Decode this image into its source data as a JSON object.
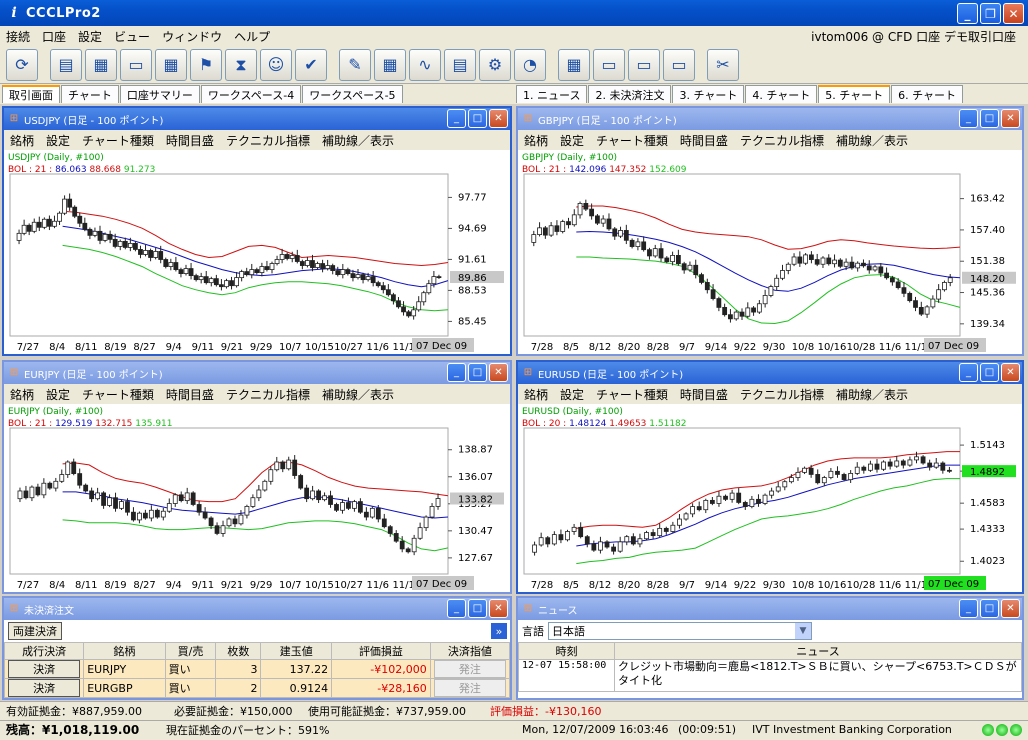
{
  "app": {
    "title": "CCCLPro2",
    "account": "ivtom006 @ CFD 口座 デモ取引口座"
  },
  "menu": [
    "接続",
    "口座",
    "設定",
    "ビュー",
    "ウィンドウ",
    "ヘルプ"
  ],
  "toolbar_icons": [
    "connect-icon",
    "order-list-icon",
    "rate-panel-icon",
    "open-book-icon",
    "calendar-icon",
    "flag-icon",
    "hourglass-icon",
    "contacts-icon",
    "clock-check-icon",
    "pen-icon",
    "spreadsheet-icon",
    "line-chart-icon",
    "document-icon",
    "settings-doc-icon",
    "signal-icon",
    "layout-icon",
    "window-icon",
    "window-minus-icon",
    "window-close-icon",
    "tools-icon"
  ],
  "left_tabs": [
    "取引画面",
    "チャート",
    "口座サマリー",
    "ワークスペース-4",
    "ワークスペース-5"
  ],
  "right_tabs": [
    "1. ニュース",
    "2. 未決済注文",
    "3. チャート",
    "4. チャート",
    "5. チャート",
    "6. チャート"
  ],
  "chart_menu": [
    "銘柄",
    "設定",
    "チャート種類",
    "時間目盛",
    "テクニカル指標",
    "補助線／表示"
  ],
  "chart_data": [
    {
      "type": "candlestick",
      "title": "USDJPY (日足 - 100 ポイント)",
      "symbol_line": "USDJPY (Daily, #100)",
      "bol_label": "BOL : 21 :",
      "bol_mid": "86.063",
      "bol_up": "88.668",
      "bol_low": "91.273",
      "yticks": [
        "97.77",
        "94.69",
        "91.61",
        "88.53",
        "85.45"
      ],
      "last": "89.86",
      "xticks": [
        "7/27",
        "8/4",
        "8/11",
        "8/19",
        "8/27",
        "9/4",
        "9/11",
        "9/21",
        "9/29",
        "10/7",
        "10/15",
        "10/27",
        "11/6",
        "11/16",
        "11/"
      ],
      "date_tag": "07 Dec 09",
      "ylim": [
        84.0,
        99.5
      ],
      "close_path": [
        93.5,
        94.2,
        95.0,
        94.4,
        95.3,
        94.8,
        95.6,
        94.9,
        95.4,
        96.2,
        97.6,
        96.8,
        95.9,
        95.2,
        94.6,
        94.0,
        94.4,
        93.5,
        94.1,
        93.6,
        92.9,
        93.4,
        92.8,
        93.2,
        92.6,
        92.1,
        92.5,
        91.8,
        92.4,
        91.6,
        90.9,
        91.3,
        90.6,
        90.2,
        90.7,
        90.0,
        89.6,
        89.9,
        89.3,
        89.7,
        89.1,
        88.9,
        89.5,
        89.0,
        89.8,
        90.4,
        90.1,
        90.6,
        90.3,
        90.9,
        90.6,
        91.2,
        91.6,
        92.1,
        91.7,
        92.0,
        91.4,
        91.0,
        91.5,
        90.8,
        91.2,
        90.7,
        91.0,
        90.5,
        90.1,
        90.6,
        90.2,
        89.8,
        90.1,
        89.6,
        89.9,
        89.3,
        89.0,
        88.6,
        88.1,
        87.5,
        86.9,
        86.4,
        86.0,
        86.6,
        87.4,
        88.3,
        89.2,
        89.9,
        89.86
      ],
      "mid_path": [
        94.9,
        94.7,
        94.5,
        94.2,
        93.9,
        93.6,
        93.2,
        92.8,
        92.4,
        91.9,
        91.4,
        91.0,
        90.6,
        90.3,
        90.1,
        90.0,
        90.1,
        90.3,
        90.5,
        90.6,
        90.7,
        90.6,
        90.4,
        90.1,
        89.8,
        89.4,
        89.1,
        88.9,
        89.1,
        89.5
      ],
      "up_path": [
        96.4,
        96.3,
        96.1,
        95.9,
        95.6,
        95.2,
        94.7,
        94.0,
        93.2,
        92.6,
        92.1,
        91.8,
        91.9,
        92.4,
        92.9,
        93.0,
        92.8,
        92.3,
        91.8,
        91.9,
        92.0,
        91.9,
        91.8,
        91.6,
        91.4,
        91.2,
        91.1,
        91.0,
        91.1,
        91.3
      ],
      "low_path": [
        93.0,
        92.8,
        92.6,
        92.3,
        91.9,
        91.4,
        90.9,
        90.2,
        89.6,
        89.0,
        88.6,
        88.3,
        88.1,
        88.3,
        88.8,
        89.1,
        89.3,
        89.4,
        89.4,
        89.3,
        89.2,
        89.0,
        88.7,
        88.4,
        88.0,
        87.4,
        86.9,
        86.6,
        86.5,
        86.6
      ]
    },
    {
      "type": "candlestick",
      "title": "GBPJPY (日足 - 100 ポイント)",
      "symbol_line": "GBPJPY (Daily, #100)",
      "bol_label": "BOL : 21 :",
      "bol_mid": "142.096",
      "bol_up": "147.352",
      "bol_low": "152.609",
      "yticks": [
        "163.42",
        "157.40",
        "151.38",
        "145.36",
        "139.34"
      ],
      "last": "148.20",
      "xticks": [
        "7/28",
        "8/5",
        "8/12",
        "8/20",
        "8/28",
        "9/7",
        "9/14",
        "9/22",
        "9/30",
        "10/8",
        "10/16",
        "10/28",
        "11/6",
        "11/16",
        "11/"
      ],
      "date_tag": "07 Dec 09",
      "ylim": [
        137.0,
        167.0
      ],
      "close_path": [
        155.0,
        156.5,
        157.8,
        156.4,
        158.2,
        157.1,
        159.0,
        158.4,
        160.3,
        162.5,
        161.4,
        160.1,
        158.7,
        159.5,
        157.6,
        156.2,
        157.3,
        155.4,
        154.2,
        155.1,
        153.6,
        152.4,
        153.8,
        152.0,
        151.3,
        152.5,
        150.9,
        149.7,
        150.6,
        148.8,
        147.3,
        145.9,
        144.2,
        142.5,
        141.1,
        140.3,
        141.6,
        140.8,
        142.4,
        141.6,
        143.2,
        144.8,
        146.5,
        148.1,
        149.6,
        150.8,
        152.2,
        151.0,
        152.6,
        151.7,
        150.8,
        152.0,
        150.9,
        151.6,
        150.4,
        151.2,
        150.1,
        151.0,
        150.5,
        149.7,
        150.3,
        149.1,
        148.2,
        147.4,
        146.3,
        145.2,
        143.8,
        142.5,
        141.2,
        142.6,
        144.1,
        145.9,
        147.3,
        148.2
      ],
      "mid_path": [
        157.0,
        157.1,
        157.0,
        156.8,
        156.5,
        156.1,
        155.6,
        155.0,
        154.2,
        153.2,
        151.9,
        150.5,
        149.1,
        147.8,
        146.7,
        145.8,
        145.6,
        146.2,
        147.3,
        148.6,
        149.7,
        150.4,
        150.8,
        150.9,
        150.6,
        150.0,
        149.4,
        148.8,
        148.4,
        148.2
      ],
      "up_path": [
        161.8,
        162.0,
        162.0,
        161.7,
        161.2,
        160.6,
        159.7,
        158.5,
        157.5,
        157.0,
        156.7,
        156.5,
        156.3,
        156.1,
        155.5,
        154.5,
        153.7,
        153.8,
        154.4,
        155.2,
        155.5,
        155.3,
        154.9,
        154.6,
        154.3,
        154.1,
        153.9,
        153.8,
        153.9,
        154.1
      ],
      "low_path": [
        152.2,
        152.2,
        152.0,
        151.9,
        151.8,
        151.6,
        151.4,
        151.0,
        150.4,
        149.0,
        146.9,
        144.6,
        142.2,
        140.3,
        139.5,
        139.4,
        139.9,
        141.5,
        143.4,
        145.4,
        147.0,
        148.2,
        148.7,
        148.8,
        148.3,
        146.9,
        145.1,
        143.8,
        143.2,
        142.5
      ]
    },
    {
      "type": "candlestick",
      "title": "EURJPY (日足 - 100 ポイント)",
      "symbol_line": "EURJPY (Daily, #100)",
      "bol_label": "BOL : 21 :",
      "bol_mid": "129.519",
      "bol_up": "132.715",
      "bol_low": "135.911",
      "yticks": [
        "138.87",
        "136.07",
        "133.27",
        "130.47",
        "127.67"
      ],
      "last": "133.82",
      "xticks": [
        "7/27",
        "8/4",
        "8/11",
        "8/19",
        "8/27",
        "9/4",
        "9/11",
        "9/21",
        "9/29",
        "10/7",
        "10/15",
        "10/27",
        "11/6",
        "11/16",
        "11/"
      ],
      "date_tag": "07 Dec 09",
      "ylim": [
        126.0,
        140.5
      ],
      "close_path": [
        133.8,
        134.6,
        133.9,
        135.0,
        134.2,
        135.4,
        134.9,
        135.6,
        136.3,
        137.6,
        136.4,
        135.2,
        134.6,
        133.8,
        134.4,
        133.1,
        133.9,
        132.8,
        133.5,
        132.4,
        131.6,
        132.3,
        131.8,
        132.6,
        131.9,
        132.5,
        133.3,
        134.2,
        133.6,
        134.4,
        133.2,
        132.4,
        131.8,
        131.0,
        130.2,
        131.0,
        131.7,
        131.2,
        132.1,
        133.0,
        133.9,
        134.7,
        135.6,
        136.8,
        137.6,
        136.9,
        137.8,
        136.2,
        134.9,
        133.8,
        134.6,
        133.7,
        134.1,
        133.2,
        132.6,
        133.4,
        132.8,
        133.5,
        132.4,
        131.9,
        132.8,
        131.7,
        130.9,
        130.2,
        129.4,
        128.6,
        128.3,
        129.7,
        130.8,
        131.9,
        133.0,
        133.82
      ],
      "mid_path": [
        134.5,
        134.5,
        134.3,
        134.1,
        133.8,
        133.6,
        133.4,
        133.1,
        132.8,
        132.6,
        132.5,
        132.4,
        132.3,
        132.2,
        132.4,
        132.8,
        133.2,
        133.6,
        133.9,
        134.0,
        133.9,
        133.7,
        133.4,
        133.1,
        132.8,
        132.5,
        132.2,
        131.9,
        131.8,
        131.9
      ],
      "up_path": [
        137.4,
        137.5,
        137.3,
        136.5,
        135.9,
        135.6,
        135.4,
        135.0,
        134.5,
        134.0,
        133.6,
        133.5,
        133.5,
        133.8,
        135.1,
        136.5,
        137.5,
        137.6,
        137.3,
        136.7,
        136.0,
        135.5,
        135.1,
        134.9,
        134.8,
        134.7,
        134.6,
        134.5,
        134.3,
        134.1
      ],
      "low_path": [
        131.6,
        131.5,
        131.3,
        131.3,
        131.3,
        131.2,
        131.0,
        130.7,
        130.6,
        130.6,
        130.7,
        130.8,
        130.8,
        130.7,
        130.6,
        130.7,
        131.0,
        131.3,
        131.4,
        131.5,
        131.5,
        131.4,
        131.2,
        130.9,
        130.6,
        130.0,
        129.2,
        128.6,
        128.4,
        128.7
      ]
    },
    {
      "type": "candlestick",
      "title": "EURUSD (日足 - 100 ポイント)",
      "symbol_line": "EURUSD (Daily, #100)",
      "bol_label": "BOL : 20 :",
      "bol_mid": "1.48124",
      "bol_up": "1.49653",
      "bol_low": "1.51182",
      "yticks": [
        "1.5143",
        "1.4892",
        "1.4583",
        "1.4333",
        "1.4023"
      ],
      "last": "1.4892",
      "xticks": [
        "7/28",
        "8/5",
        "8/12",
        "8/20",
        "8/28",
        "9/7",
        "9/14",
        "9/22",
        "9/30",
        "10/8",
        "10/16",
        "10/28",
        "11/6",
        "11/16",
        "11/"
      ],
      "date_tag": "07 Dec 09",
      "ylim": [
        1.39,
        1.525
      ],
      "close_path": [
        1.411,
        1.418,
        1.425,
        1.419,
        1.428,
        1.423,
        1.431,
        1.435,
        1.426,
        1.419,
        1.413,
        1.421,
        1.416,
        1.412,
        1.421,
        1.426,
        1.419,
        1.424,
        1.43,
        1.427,
        1.434,
        1.431,
        1.437,
        1.443,
        1.448,
        1.455,
        1.452,
        1.461,
        1.458,
        1.465,
        1.462,
        1.468,
        1.459,
        1.455,
        1.462,
        1.458,
        1.466,
        1.47,
        1.474,
        1.479,
        1.483,
        1.488,
        1.492,
        1.486,
        1.478,
        1.483,
        1.489,
        1.486,
        1.481,
        1.487,
        1.493,
        1.49,
        1.496,
        1.491,
        1.498,
        1.494,
        1.499,
        1.495,
        1.5,
        1.503,
        1.497,
        1.493,
        1.497,
        1.49,
        1.4892
      ],
      "mid_path": [
        1.417,
        1.419,
        1.42,
        1.421,
        1.421,
        1.422,
        1.424,
        1.428,
        1.433,
        1.438,
        1.444,
        1.449,
        1.453,
        1.456,
        1.459,
        1.461,
        1.464,
        1.468,
        1.472,
        1.476,
        1.479,
        1.482,
        1.484,
        1.486,
        1.488,
        1.49,
        1.492,
        1.494,
        1.495,
        1.495
      ],
      "up_path": [
        1.434,
        1.436,
        1.437,
        1.437,
        1.436,
        1.435,
        1.437,
        1.444,
        1.453,
        1.461,
        1.467,
        1.471,
        1.473,
        1.474,
        1.475,
        1.478,
        1.483,
        1.489,
        1.495,
        1.499,
        1.501,
        1.502,
        1.502,
        1.502,
        1.503,
        1.505,
        1.506,
        1.507,
        1.508,
        1.508
      ],
      "low_path": [
        1.4,
        1.402,
        1.403,
        1.405,
        1.406,
        1.409,
        1.411,
        1.412,
        1.413,
        1.415,
        1.421,
        1.427,
        1.433,
        1.438,
        1.443,
        1.445,
        1.446,
        1.448,
        1.45,
        1.453,
        1.457,
        1.462,
        1.466,
        1.47,
        1.473,
        1.475,
        1.478,
        1.481,
        1.482,
        1.482
      ]
    }
  ],
  "orders": {
    "title": "未決済注文",
    "settle_all": "両建決済",
    "headers": [
      "成行決済",
      "銘柄",
      "買/売",
      "枚数",
      "建玉値",
      "評価損益",
      "決済指値"
    ],
    "rows": [
      {
        "btn": "決済",
        "sym": "EURJPY",
        "side": "買い",
        "qty": "3",
        "price": "137.22",
        "pl": "-¥102,000",
        "lim": "発注"
      },
      {
        "btn": "決済",
        "sym": "EURGBP",
        "side": "買い",
        "qty": "2",
        "price": "0.9124",
        "pl": "-¥28,160",
        "lim": "発注"
      }
    ]
  },
  "news": {
    "title": "ニュース",
    "lang_label": "言語",
    "lang": "日本語",
    "col_time": "時刻",
    "col_news": "ニュース",
    "items": [
      {
        "time": "12-07 15:58:00",
        "text": "クレジット市場動向＝鹿島&lt;1812.T&gt;ＳＢに買い、シャープ&lt;6753.T&gt;ＣＤＳがタイト化"
      }
    ]
  },
  "status": {
    "valid_margin": "有効証拠金：¥887,959.00",
    "req_margin": "必要証拠金：¥150,000",
    "avail_margin": "使用可能証拠金：¥737,959.00",
    "unrealized": "評価損益：-¥130,160",
    "balance": "残高：¥1,018,119.00",
    "margin_pct": "現在証拠金のパーセント：591%",
    "datetime": "Mon, 12/07/2009 16:03:46",
    "elapsed": "(00:09:51)",
    "company": "IVT Investment Banking Corporation"
  },
  "colors": {
    "title_blue": "#0a5ed8",
    "bol_upper": "#d01010",
    "bol_mid": "#1010c0",
    "bol_lower": "#20c020",
    "candle_up": "#ffffff",
    "candle_down": "#202020",
    "tag": "#c8c8c8",
    "tag_green": "#20e020"
  }
}
